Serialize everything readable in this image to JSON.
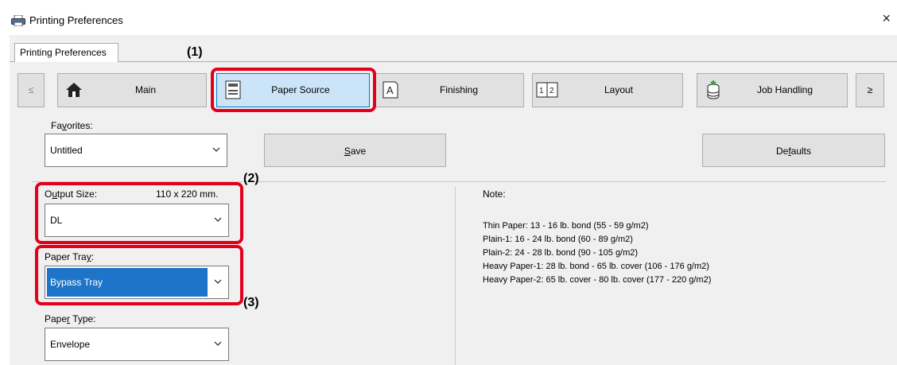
{
  "window": {
    "title": "Printing Preferences",
    "close_glyph": "×"
  },
  "tab": {
    "label": "Printing Preferences"
  },
  "callouts": [
    "(1)",
    "(2)",
    "(3)"
  ],
  "nav": {
    "prev": "≤",
    "next": "≥",
    "items": [
      {
        "label": "Main",
        "icon": "home-icon"
      },
      {
        "label": "Paper Source",
        "icon": "printer-paper-icon",
        "selected": true
      },
      {
        "label": "Finishing",
        "icon": "finishing-icon"
      },
      {
        "label": "Layout",
        "icon": "layout-icon"
      },
      {
        "label": "Job Handling",
        "icon": "job-handling-icon"
      }
    ]
  },
  "favorites": {
    "label_pre": "Fa",
    "label_u": "v",
    "label_post": "orites:",
    "value": "Untitled"
  },
  "save": {
    "label_u": "S",
    "label_post": "ave"
  },
  "defaults": {
    "label_pre": "De",
    "label_u": "f",
    "label_post": "aults"
  },
  "output_size": {
    "label_pre": "O",
    "label_u": "u",
    "label_post": "tput Size:",
    "dimensions": "110 x 220 mm.",
    "value": "DL"
  },
  "paper_tray": {
    "label_pre": "Paper Tra",
    "label_u": "y",
    "label_post": ":",
    "value": "Bypass Tray"
  },
  "paper_type": {
    "label_pre": "Pape",
    "label_u": "r",
    "label_post": " Type:",
    "value": "Envelope"
  },
  "note": {
    "heading": "Note:",
    "lines": [
      "Thin Paper: 13 - 16 lb. bond (55 - 59 g/m2)",
      "Plain-1: 16 - 24 lb. bond (60 - 89 g/m2)",
      "Plain-2: 24 - 28 lb. bond (90 - 105 g/m2)",
      "Heavy Paper-1: 28 lb. bond - 65 lb. cover (106 - 176 g/m2)",
      "Heavy Paper-2: 65 lb. cover - 80 lb. cover (177 - 220 g/m2)"
    ]
  },
  "colors": {
    "callout": "#e3001b",
    "selected_fill": "#1e74c8",
    "selected_tab": "#cce4f7"
  }
}
